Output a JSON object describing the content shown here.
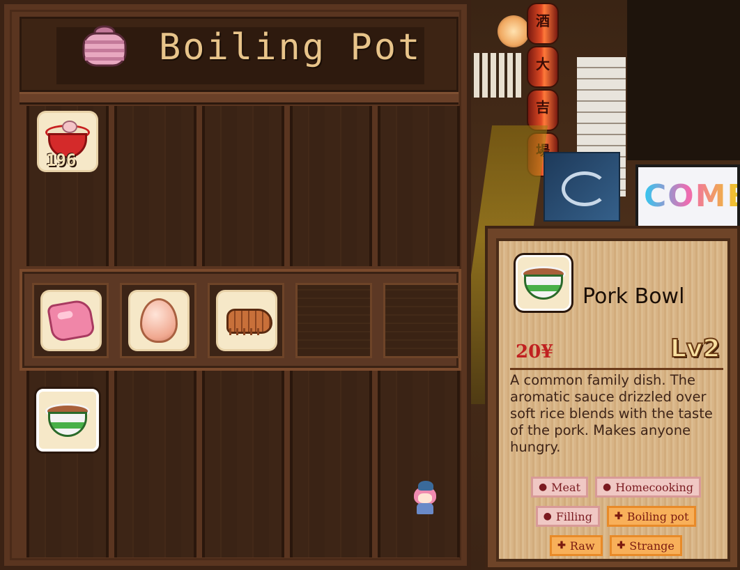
{
  "panel": {
    "title": "Boiling Pot",
    "stock_items": [
      {
        "name": "ramen",
        "icon": "ramen-bowl-icon",
        "quantity": "196"
      }
    ],
    "ingredients": [
      {
        "name": "meat",
        "icon": "meat-icon"
      },
      {
        "name": "egg",
        "icon": "egg-icon"
      },
      {
        "name": "shrimp",
        "icon": "shrimp-icon"
      }
    ],
    "recipes": [
      {
        "name": "pork-bowl",
        "icon": "pork-bowl-icon",
        "selected": true
      }
    ]
  },
  "tooltip": {
    "dish_name": "Pork Bowl",
    "price": "20¥",
    "level": "Lv2",
    "description": "A common family dish. The aromatic sauce drizzled over soft rice blends with the taste of the pork. Makes anyone hungry.",
    "tags_row1": [
      {
        "label": "Meat",
        "mark": "●",
        "kind": "like"
      },
      {
        "label": "Homecooking",
        "mark": "●",
        "kind": "like"
      }
    ],
    "tags_row2": [
      {
        "label": "Filling",
        "mark": "●",
        "kind": "like"
      },
      {
        "label": "Boiling pot",
        "mark": "✚",
        "kind": "boost"
      }
    ],
    "tags_row3": [
      {
        "label": "Raw",
        "mark": "✚",
        "kind": "boost"
      },
      {
        "label": "Strange",
        "mark": "✚",
        "kind": "boost"
      }
    ]
  },
  "scene": {
    "sign_text": "COMBO",
    "lantern_glyphs": [
      "酒",
      "大",
      "吉",
      "場"
    ]
  },
  "colors": {
    "price": "#c02020",
    "title": "#e8c48a",
    "panel_wood": "#5a3520",
    "tag_like": "#f0c8c4",
    "tag_boost": "#f8b05a"
  }
}
